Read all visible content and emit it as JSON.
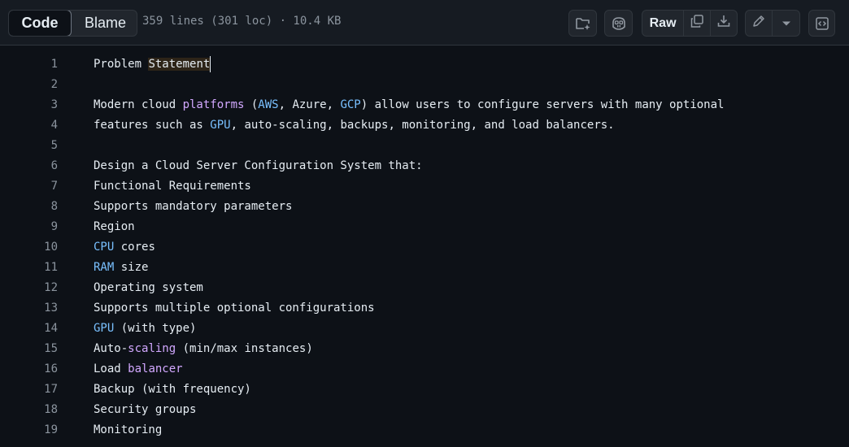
{
  "toolbar": {
    "code_tab": "Code",
    "blame_tab": "Blame",
    "file_info": "359 lines (301 loc) · 10.4 KB",
    "raw_label": "Raw"
  },
  "lines": [
    {
      "n": "1",
      "parts": [
        {
          "t": "Problem "
        },
        {
          "t": "Statement",
          "c": "hl"
        }
      ],
      "cursor": true
    },
    {
      "n": "2",
      "parts": []
    },
    {
      "n": "3",
      "parts": [
        {
          "t": "Modern cloud "
        },
        {
          "t": "platforms",
          "c": "kw-purple"
        },
        {
          "t": " ("
        },
        {
          "t": "AWS",
          "c": "kw-blue"
        },
        {
          "t": ", Azure, "
        },
        {
          "t": "GCP",
          "c": "kw-blue"
        },
        {
          "t": ") allow users to configure servers with many optional"
        }
      ]
    },
    {
      "n": "4",
      "parts": [
        {
          "t": "features such as "
        },
        {
          "t": "GPU",
          "c": "kw-blue"
        },
        {
          "t": ", auto-scaling, backups, monitoring, and load balancers."
        }
      ]
    },
    {
      "n": "5",
      "parts": []
    },
    {
      "n": "6",
      "parts": [
        {
          "t": "Design a Cloud Server Configuration System that:"
        }
      ]
    },
    {
      "n": "7",
      "parts": [
        {
          "t": "Functional Requirements"
        }
      ]
    },
    {
      "n": "8",
      "parts": [
        {
          "t": "Supports mandatory parameters"
        }
      ]
    },
    {
      "n": "9",
      "parts": [
        {
          "t": "Region"
        }
      ]
    },
    {
      "n": "10",
      "parts": [
        {
          "t": "CPU",
          "c": "kw-blue"
        },
        {
          "t": " cores"
        }
      ]
    },
    {
      "n": "11",
      "parts": [
        {
          "t": "RAM",
          "c": "kw-blue"
        },
        {
          "t": " size"
        }
      ]
    },
    {
      "n": "12",
      "parts": [
        {
          "t": "Operating system"
        }
      ]
    },
    {
      "n": "13",
      "parts": [
        {
          "t": "Supports multiple optional configurations"
        }
      ]
    },
    {
      "n": "14",
      "parts": [
        {
          "t": "GPU",
          "c": "kw-blue"
        },
        {
          "t": " (with type)"
        }
      ]
    },
    {
      "n": "15",
      "parts": [
        {
          "t": "Auto-"
        },
        {
          "t": "scaling",
          "c": "kw-purple"
        },
        {
          "t": " (min/max instances)"
        }
      ]
    },
    {
      "n": "16",
      "parts": [
        {
          "t": "Load "
        },
        {
          "t": "balancer",
          "c": "kw-purple"
        }
      ]
    },
    {
      "n": "17",
      "parts": [
        {
          "t": "Backup (with frequency)"
        }
      ]
    },
    {
      "n": "18",
      "parts": [
        {
          "t": "Security groups"
        }
      ]
    },
    {
      "n": "19",
      "parts": [
        {
          "t": "Monitoring"
        }
      ]
    }
  ]
}
